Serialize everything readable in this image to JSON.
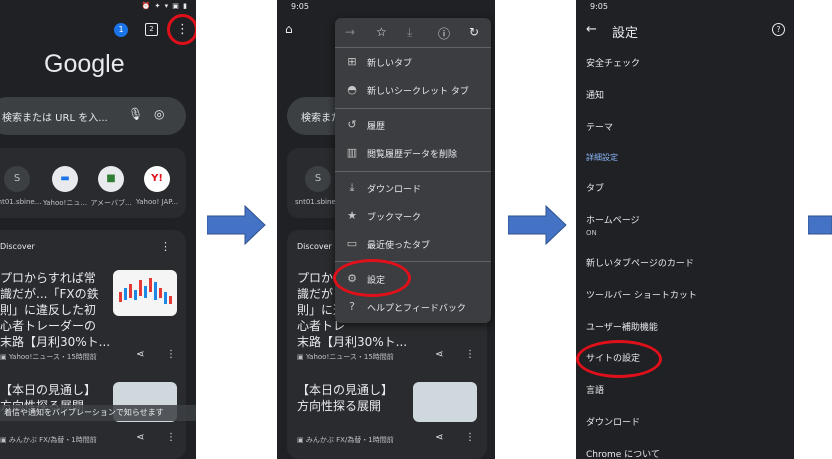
{
  "colors": {
    "background": "#202124",
    "surface": "#2a2b2e",
    "menu": "#3c3d40",
    "accent": "#8ab4f8",
    "highlight": "#e0101a",
    "arrow": "#4472c4"
  },
  "screen1": {
    "tab_count": "2",
    "account_badge": "1",
    "logo": "Google",
    "search_placeholder": "検索または URL を入...",
    "shortcuts": [
      "snt01.sbine...",
      "Yahoo!ニュ...",
      "アメーバブ...",
      "Yahoo! JAP..."
    ],
    "shortcut_letters": [
      "S",
      "",
      "",
      "Y!"
    ],
    "discover_label": "Discover",
    "article1": {
      "title_lines": [
        "プロからすれば常",
        "識だが...「FXの鉄",
        "則」に違反した初",
        "心者トレーダーの",
        "末路【月利30%ト..."
      ],
      "source": "Yahoo!ニュース・15時間前"
    },
    "article2": {
      "title_lines": [
        "【本日の見通し】",
        "方向性探る展開"
      ],
      "source": "みんかぶ FX/為替・1時間前"
    },
    "toast": "着信や通知をバイブレーションで知らせます"
  },
  "screen2": {
    "status_time": "9:05",
    "search_placeholder": "検索また",
    "menu_items": [
      {
        "icon": "new-tab-icon",
        "glyph": "⊞",
        "label": "新しいタブ"
      },
      {
        "icon": "incognito-icon",
        "glyph": "◓",
        "label": "新しいシークレット タブ"
      },
      {
        "icon": "history-icon",
        "glyph": "↺",
        "label": "履歴"
      },
      {
        "icon": "trash-icon",
        "glyph": "🗑",
        "label": "閲覧履歴データを削除"
      },
      {
        "icon": "download-icon",
        "glyph": "⤓",
        "label": "ダウンロード"
      },
      {
        "icon": "star-icon",
        "glyph": "★",
        "label": "ブックマーク"
      },
      {
        "icon": "devices-icon",
        "glyph": "▭",
        "label": "最近使ったタブ"
      },
      {
        "icon": "gear-icon",
        "glyph": "⚙",
        "label": "設定"
      },
      {
        "icon": "help-icon",
        "glyph": "?",
        "label": "ヘルプとフィードバック"
      }
    ],
    "shortcut": "snt01.sbine...",
    "discover_label": "Discover",
    "article1": {
      "title_lines": [
        "プロか",
        "識だが",
        "則」に違",
        "心者トレ",
        "末路【月利30%ト..."
      ],
      "source": "Yahoo!ニュース・15時間前"
    },
    "article2": {
      "title_lines": [
        "【本日の見通し】",
        "方向性探る展開"
      ],
      "source": "みんかぶ FX/為替・1時間前"
    }
  },
  "screen3": {
    "status_time": "9:05",
    "title": "設定",
    "rows": [
      {
        "label": "安全チェック",
        "sub": ""
      },
      {
        "label": "通知",
        "sub": ""
      },
      {
        "label": "テーマ",
        "sub": ""
      },
      {
        "label": "詳細設定",
        "sub": "",
        "section": true
      },
      {
        "label": "タブ",
        "sub": ""
      },
      {
        "label": "ホームページ",
        "sub": "ON"
      },
      {
        "label": "新しいタブページのカード",
        "sub": ""
      },
      {
        "label": "ツールバー ショートカット",
        "sub": ""
      },
      {
        "label": "ユーザー補助機能",
        "sub": ""
      },
      {
        "label": "サイトの設定",
        "sub": ""
      },
      {
        "label": "言語",
        "sub": ""
      },
      {
        "label": "ダウンロード",
        "sub": ""
      },
      {
        "label": "Chrome について",
        "sub": ""
      }
    ]
  }
}
